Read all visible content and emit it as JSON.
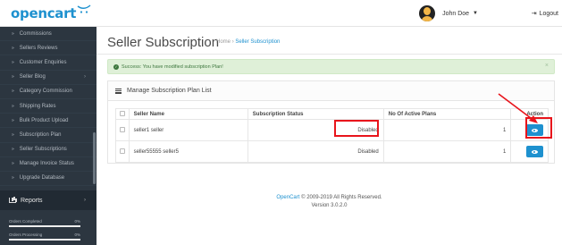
{
  "header": {
    "logo_text": "opencart",
    "user_name": "John Doe",
    "logout_label": "Logout"
  },
  "sidebar": {
    "items": [
      {
        "label": "Commissions",
        "has_arrow": false
      },
      {
        "label": "Sellers Reviews",
        "has_arrow": false
      },
      {
        "label": "Customer Enquiries",
        "has_arrow": false
      },
      {
        "label": "Seller Blog",
        "has_arrow": true
      },
      {
        "label": "Category Commission",
        "has_arrow": false
      },
      {
        "label": "Shipping Rates",
        "has_arrow": false
      },
      {
        "label": "Bulk Product Upload",
        "has_arrow": false
      },
      {
        "label": "Subscription Plan",
        "has_arrow": false
      },
      {
        "label": "Seller Subscriptions",
        "has_arrow": false
      },
      {
        "label": "Manage Invoice Status",
        "has_arrow": false
      },
      {
        "label": "Upgrade Database",
        "has_arrow": false
      }
    ],
    "reports_label": "Reports",
    "stats": [
      {
        "label": "Orders Completed",
        "value": "0%"
      },
      {
        "label": "Orders Processing",
        "value": "0%"
      }
    ]
  },
  "page": {
    "title": "Seller Subscription",
    "breadcrumb": [
      "Home",
      "Seller Subscription"
    ],
    "breadcrumb_sep": "›"
  },
  "alert": {
    "message": "Success: You have modified subscription Plan!",
    "close": "×"
  },
  "panel": {
    "title": "Manage Subscription Plan List",
    "columns": [
      "Seller Name",
      "Subscription Status",
      "No Of Active Plans",
      "Action"
    ],
    "rows": [
      {
        "seller": "seller1 seller",
        "status": "Disabled",
        "active_plans": "1"
      },
      {
        "seller": "seller55555 seller5",
        "status": "Disabled",
        "active_plans": "1"
      }
    ]
  },
  "footer": {
    "link": "OpenCart",
    "text": " © 2009-2019 All Rights Reserved.",
    "version": "Version 3.0.2.0"
  },
  "colors": {
    "accent": "#1e91cf",
    "sidebar_bg": "#2c3640",
    "success_bg": "#dff0d8",
    "annotation_red": "#e8141b"
  }
}
